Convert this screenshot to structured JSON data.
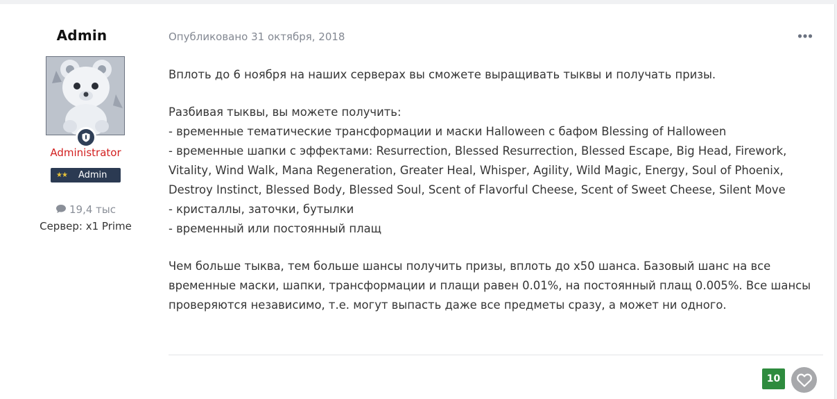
{
  "author": {
    "name": "Admin",
    "role": "Administrator",
    "group_badge": "Admin",
    "posts_count": "19,4 тыс",
    "server": "Сервер: x1 Prime"
  },
  "post": {
    "published": "Опубликовано 31 октября, 2018",
    "paragraphs": [
      [
        "Вплоть до 6 ноября на наших серверах вы сможете выращивать тыквы и получать призы."
      ],
      [
        "Разбивая тыквы, вы можете получить:",
        "- временные тематические трансформации и маски Halloween с бафом Blessing of Halloween",
        "- временные шапки с эффектами: Resurrection, Blessed Resurrection, Blessed Escape, Big Head, Firework, Vitality, Wind Walk, Mana Regeneration, Greater Heal, Whisper, Agility, Wild Magic, Energy, Soul of Phoenix, Destroy Instinct, Blessed Body, Blessed Soul, Scent of Flavorful Cheese, Scent of Sweet Cheese, Silent Move",
        "- кристаллы, заточки, бутылки",
        "- временный или постоянный плащ"
      ],
      [
        "Чем больше тыква, тем больше шансы получить призы, вплоть до x50 шанса. Базовый шанс на все временные маски, шапки, трансформации и плащи равен 0.01%, на постоянный плащ 0.005%. Все шансы проверяются независимо, т.е. могут выпасть даже все предметы сразу, а может ни одного."
      ]
    ]
  },
  "reactions": {
    "count": "10"
  },
  "icons": {
    "more": "ellipsis-icon",
    "comment": "comment-icon",
    "rank": "shield-icon",
    "reaction": "heart-icon"
  },
  "colors": {
    "role": "#d21f1f",
    "badge_bg": "#2b3a52",
    "reaction_count_bg": "#2e8b3e"
  }
}
